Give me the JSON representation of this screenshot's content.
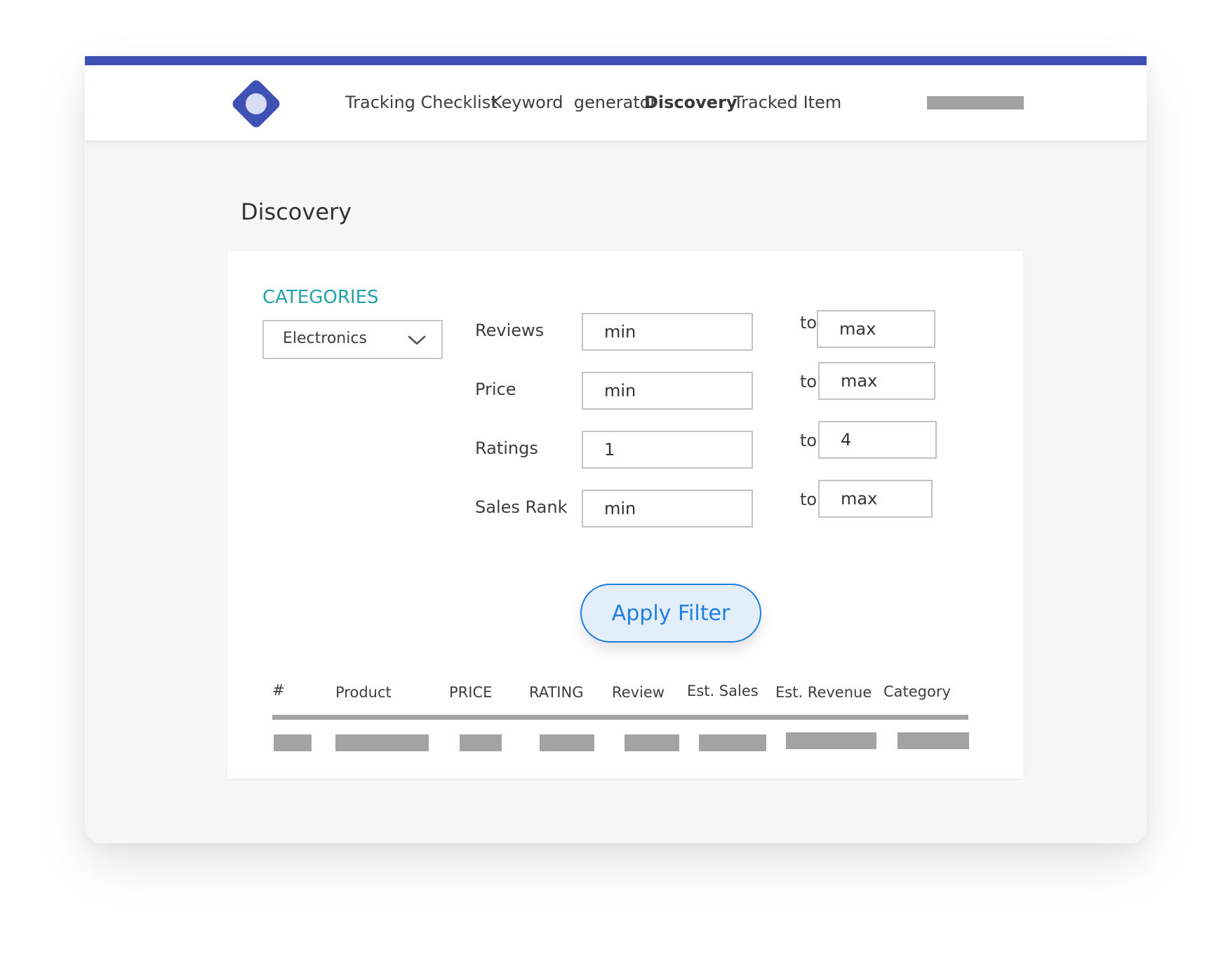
{
  "nav": {
    "items": [
      {
        "label": "Tracking Checklist",
        "active": false
      },
      {
        "label": "Keyword  generator",
        "active": false
      },
      {
        "label": "Discovery",
        "active": true
      },
      {
        "label": "Tracked Item",
        "active": false
      }
    ]
  },
  "page": {
    "title": "Discovery"
  },
  "filters": {
    "categories_label": "CATEGORIES",
    "category_selected": "Electronics",
    "to_label": "to",
    "rows": [
      {
        "label": "Reviews",
        "min_placeholder": "min",
        "max_placeholder": "max",
        "min_value": "",
        "max_value": ""
      },
      {
        "label": "Price",
        "min_placeholder": "min",
        "max_placeholder": "max",
        "min_value": "",
        "max_value": ""
      },
      {
        "label": "Ratings",
        "min_placeholder": "min",
        "max_placeholder": "max",
        "min_value": "1",
        "max_value": "4"
      },
      {
        "label": "Sales Rank",
        "min_placeholder": "min",
        "max_placeholder": "max",
        "min_value": "",
        "max_value": ""
      }
    ],
    "apply_label": "Apply Filter"
  },
  "table": {
    "columns": [
      "#",
      "Product",
      "PRICE",
      "RATING",
      "Review",
      "Est. Sales",
      "Est. Revenue",
      "Category"
    ]
  },
  "colors": {
    "accent": "#3f51b5",
    "categories_teal": "#22a3a9",
    "button_blue": "#1f7ee0",
    "button_fill": "#e3eefb",
    "placeholder_gray": "#a3a3a3"
  },
  "icons": {
    "logo": "diamond-logo-icon",
    "dropdown": "chevron-down-icon"
  }
}
